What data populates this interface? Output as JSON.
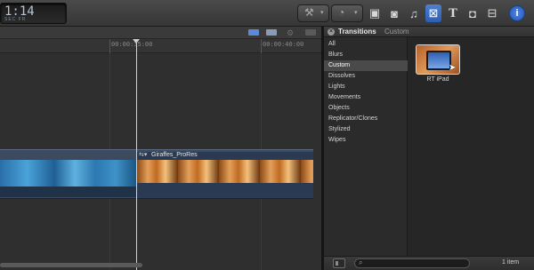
{
  "toolbar": {
    "timecode": "1:14",
    "timecode_sub": "SEC  FR",
    "buttons": [
      "video-icon",
      "audio-icon",
      "photo-icon",
      "music-icon",
      "transitions-icon",
      "titles-icon",
      "generators-icon",
      "themes-icon",
      "inspector-icon"
    ]
  },
  "timeline": {
    "ruler_labels": [
      "00:00:35:00",
      "00:00:40:00"
    ],
    "clip_b_name": "Giraffes_ProRes"
  },
  "browser": {
    "title": "Transitions",
    "subtitle": "Custom",
    "categories": [
      "All",
      "Blurs",
      "Custom",
      "Dissolves",
      "Lights",
      "Movements",
      "Objects",
      "Replicator/Clones",
      "Stylized",
      "Wipes"
    ],
    "selected_category": "Custom",
    "items": [
      {
        "label": "RT iPad"
      }
    ],
    "item_count": "1 item",
    "search_placeholder": ""
  }
}
